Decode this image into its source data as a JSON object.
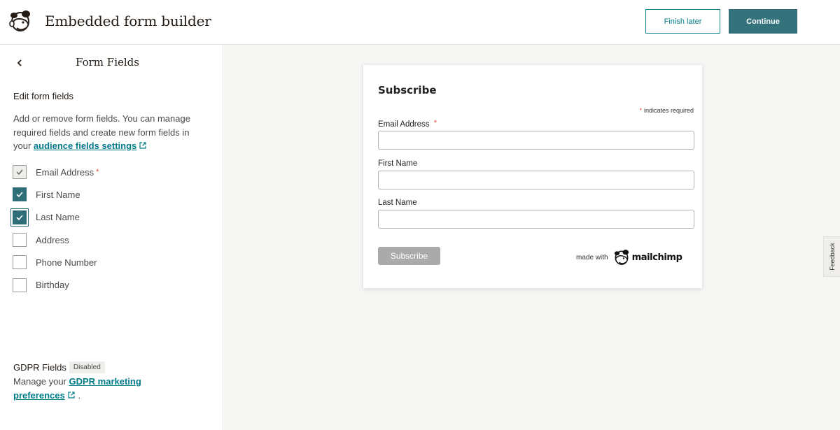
{
  "header": {
    "title": "Embedded form builder",
    "finish_later_label": "Finish later",
    "continue_label": "Continue",
    "brand_color": "#35737c"
  },
  "sidebar": {
    "panel_title": "Form Fields",
    "section_heading": "Edit form fields",
    "help_text_before_link": "Add or remove form fields. You can manage required fields and create new form fields in your ",
    "help_link_text": "audience fields settings",
    "fields": [
      {
        "label": "Email Address",
        "checked": true,
        "disabled": true,
        "required": true,
        "required_mark": "*"
      },
      {
        "label": "First Name",
        "checked": true,
        "disabled": false,
        "required": false
      },
      {
        "label": "Last Name",
        "checked": true,
        "disabled": false,
        "required": false,
        "focused": true
      },
      {
        "label": "Address",
        "checked": false,
        "disabled": false,
        "required": false
      },
      {
        "label": "Phone Number",
        "checked": false,
        "disabled": false,
        "required": false
      },
      {
        "label": "Birthday",
        "checked": false,
        "disabled": false,
        "required": false
      }
    ],
    "gdpr": {
      "title": "GDPR Fields",
      "badge": "Disabled",
      "text_before_link": "Manage your ",
      "link_text": "GDPR marketing preferences",
      "text_after_link": "."
    }
  },
  "form_preview": {
    "heading": "Subscribe",
    "required_mark": "*",
    "required_note": "indicates required",
    "fields": [
      {
        "label": "Email Address",
        "required": true,
        "value": ""
      },
      {
        "label": "First Name",
        "required": false,
        "value": ""
      },
      {
        "label": "Last Name",
        "required": false,
        "value": ""
      }
    ],
    "submit_label": "Subscribe",
    "made_with": "made with",
    "brand_word": "mailchimp"
  },
  "feedback_label": "Feedback"
}
